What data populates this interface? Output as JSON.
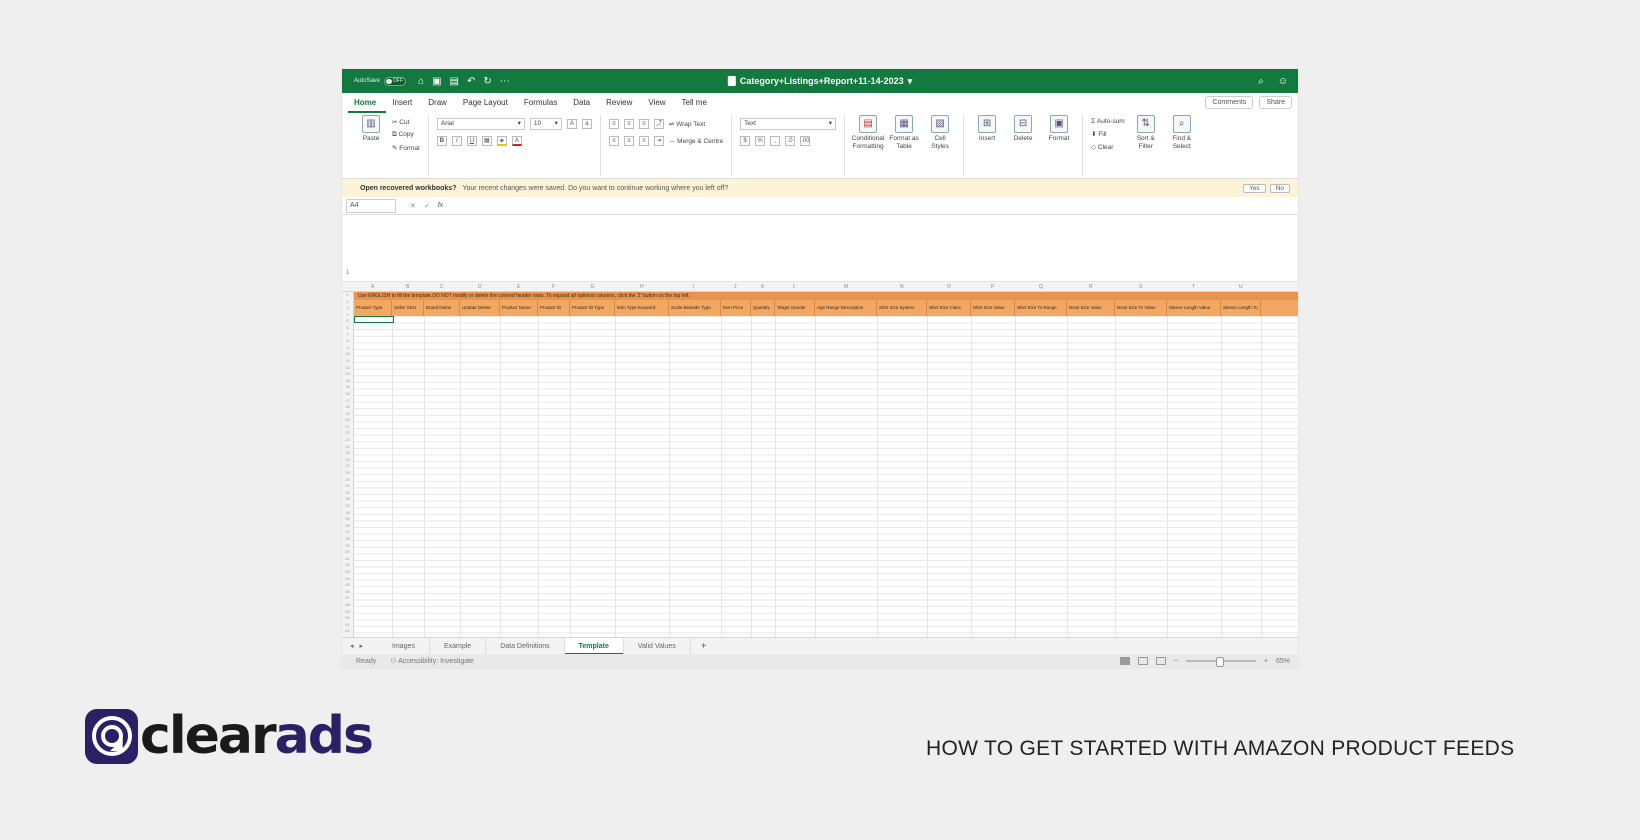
{
  "window": {
    "autosave_label": "AutoSave",
    "autosave_state": "OFF",
    "title": "Category+Listings+Report+11-14-2023"
  },
  "menu": {
    "tabs": [
      "Home",
      "Insert",
      "Draw",
      "Page Layout",
      "Formulas",
      "Data",
      "Review",
      "View",
      "Tell me"
    ],
    "comments": "Comments",
    "share": "Share"
  },
  "ribbon": {
    "paste": "Paste",
    "cut": "Cut",
    "copy": "Copy",
    "format": "Format",
    "font": "Arial",
    "font_size": "10",
    "wrap_text": "Wrap Text",
    "merge_centre": "Merge & Centre",
    "number_format": "Text",
    "conditional_formatting": "Conditional Formatting",
    "format_as_table": "Format as Table",
    "cell_styles": "Cell Styles",
    "insert": "Insert",
    "delete": "Delete",
    "format_cells": "Format",
    "autosum": "Auto-sum",
    "fill": "Fill",
    "clear": "Clear",
    "sort_filter": "Sort & Filter",
    "find_select": "Find & Select"
  },
  "infobar": {
    "bold": "Open recovered workbooks?",
    "message": "Your recent changes were saved. Do you want to continue working where you left off?",
    "yes": "Yes",
    "no": "No"
  },
  "formula": {
    "namebox": "A4",
    "fx": "fx"
  },
  "sheet": {
    "row1_text": "Use ENGLISH to fill the template.DO NOT modify or delete the colored header rows. To expand all optional columns, click the '2' button on the top left.",
    "headers": [
      "Product Type",
      "Seller SKU",
      "Brand Name",
      "Update Delete",
      "Product Name",
      "Product ID",
      "Product ID Type",
      "Item Type Keyword",
      "Scale Bedside Type",
      "Item Price",
      "Quantity",
      "Target Gender",
      "Age Range Description",
      "Shirt Size System",
      "Shirt Size Class",
      "Shirt Size Value",
      "Shirt Size To Range",
      "Neck Size Value",
      "Neck Size To Value",
      "Sleeve Length Value",
      "Sleeve Length To"
    ]
  },
  "sheettabs": [
    "Images",
    "Example",
    "Data Definitions",
    "Template",
    "Valid Values"
  ],
  "status": {
    "ready": "Ready",
    "accessibility": "Accessibility: Investigate",
    "zoom": "65%"
  },
  "brand": {
    "logo_dark": "clear",
    "logo_accent": "ads"
  },
  "caption": "HOW TO GET STARTED WITH AMAZON PRODUCT FEEDS"
}
